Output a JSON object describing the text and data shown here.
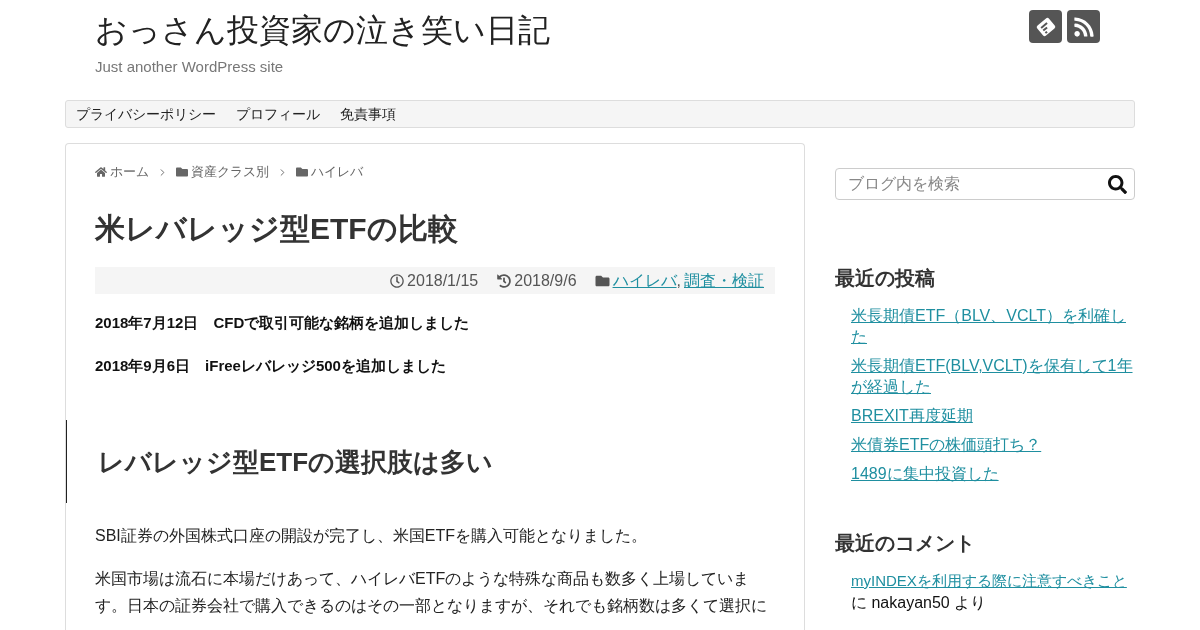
{
  "site": {
    "title": "おっさん投資家の泣き笑い日記",
    "tagline": "Just another WordPress site"
  },
  "nav": {
    "items": [
      "プライバシーポリシー",
      "プロフィール",
      "免責事項"
    ]
  },
  "breadcrumb": [
    {
      "kind": "home",
      "label": "ホーム"
    },
    {
      "kind": "category",
      "label": "資産クラス別"
    },
    {
      "kind": "category",
      "label": "ハイレバ"
    }
  ],
  "article": {
    "title": "米レバレッジ型ETFの比較",
    "meta": {
      "published": "2018/1/15",
      "updated": "2018/9/6",
      "categories": [
        "ハイレバ",
        "調査・検証"
      ],
      "separator": ","
    },
    "notices": [
      "2018年7月12日　CFDで取引可能な銘柄を追加しました",
      "2018年9月6日　iFreeレバレッジ500を追加しました"
    ],
    "heading": "レバレッジ型ETFの選択肢は多い",
    "paragraphs": [
      "SBI証券の外国株式口座の開設が完了し、米国ETFを購入可能となりました。",
      "米国市場は流石に本場だけあって、ハイレバETFのような特殊な商品も数多く上場しています。日本の証券会社で購入できるのはその一部となりますが、それでも銘柄数は多くて選択に"
    ]
  },
  "sidebar": {
    "search": {
      "placeholder": "ブログ内を検索"
    },
    "recent_posts": {
      "title": "最近の投稿",
      "items": [
        "米長期債ETF（BLV、VCLT）を利確した",
        "米長期債ETF(BLV,VCLT)を保有して1年が経過した",
        "BREXIT再度延期",
        "米債券ETFの株価頭打ち？",
        "1489に集中投資した"
      ]
    },
    "recent_comments": {
      "title": "最近のコメント",
      "items": [
        {
          "post": "myINDEXを利用する際に注意すべきこと",
          "text": "に nakayan50 より"
        }
      ]
    }
  }
}
